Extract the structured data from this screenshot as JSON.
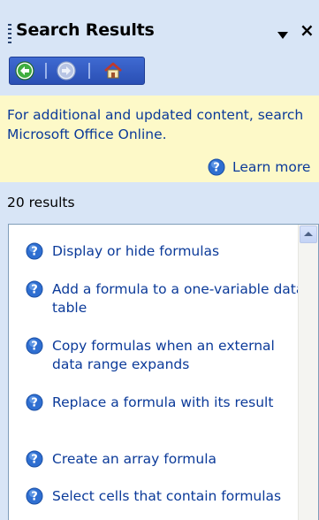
{
  "pane": {
    "title": "Search Results"
  },
  "info": {
    "message": "For additional and updated content, search Microsoft Office Online.",
    "learn_more": "Learn more"
  },
  "results": {
    "count_label": "20 results",
    "items": [
      {
        "label": "Display or hide formulas"
      },
      {
        "label": "Add a formula to a one-variable data table"
      },
      {
        "label": "Copy formulas when an external data range expands"
      },
      {
        "label": "Replace a formula with its result"
      },
      {
        "label": "Create an array formula"
      },
      {
        "label": "Select cells that contain formulas"
      }
    ]
  },
  "colors": {
    "pane_background": "#d8e5f6",
    "link_text": "#0b3a99",
    "info_background": "#fdf9c8",
    "toolbar": "#2f56c0"
  },
  "icons": {
    "back": "back-arrow-icon",
    "forward": "forward-arrow-icon",
    "home": "home-icon",
    "help": "help-question-icon"
  }
}
